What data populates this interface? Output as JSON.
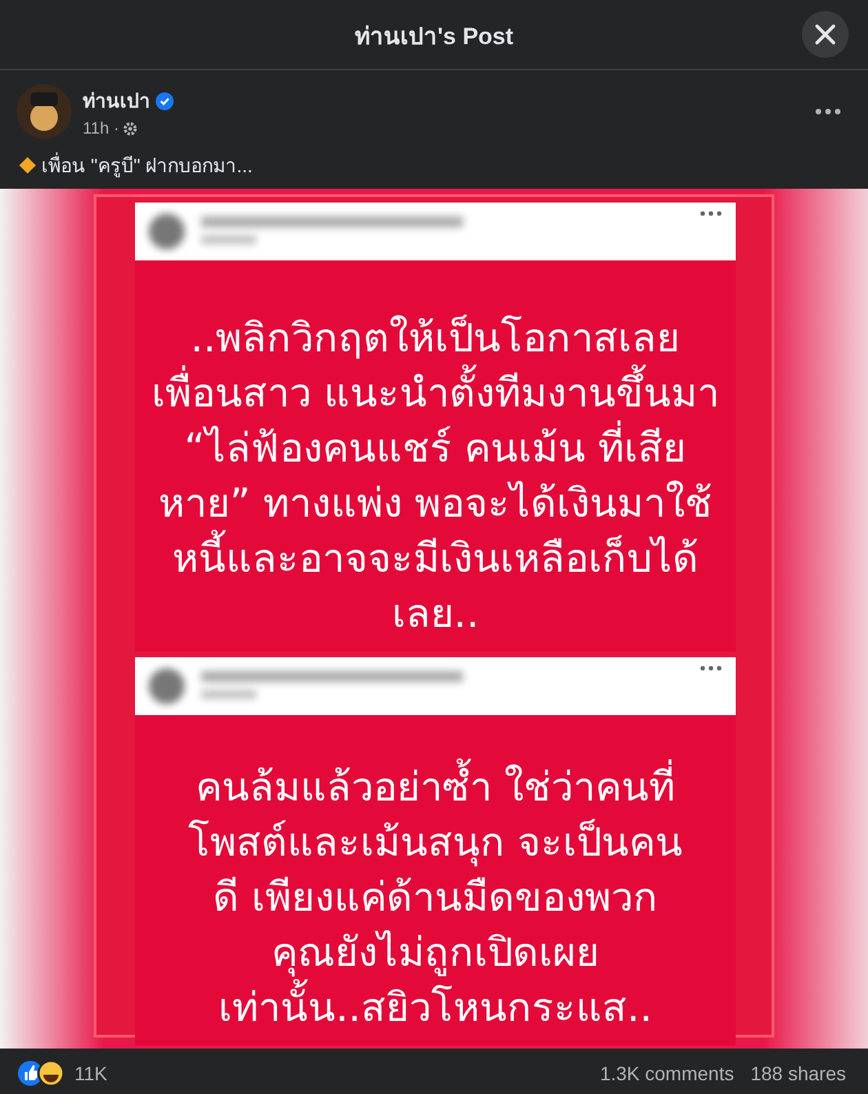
{
  "dialog": {
    "title": "ท่านเปา's Post"
  },
  "post": {
    "author": "ท่านเปา",
    "verified": true,
    "time": "11h ·",
    "text": "เพื่อน \"ครูบี\" ฝากบอกมา..."
  },
  "image": {
    "cards": [
      {
        "lines": [
          "..พลิกวิกฤตให้เป็นโอกาสเลย",
          "เพื่อนสาว แนะนำตั้งทีมงานขึ้นมา",
          "“ไล่ฟ้องคนแชร์ คนเม้น ที่เสีย",
          "หาย” ทางแพ่ง พอจะได้เงินมาใช้",
          "หนี้และอาจจะมีเงินเหลือเก็บได้",
          "เลย.."
        ]
      },
      {
        "lines": [
          "คนล้มแล้วอย่าซ้ำ ใช่ว่าคนที่",
          "โพสต์และเม้นสนุก จะเป็นคน",
          "ดี เพียงแค่ด้านมืดของพวก",
          "คุณยังไม่ถูกเปิดเผย",
          "เท่านั้น..สยิวโหนกระแส.."
        ]
      }
    ]
  },
  "footer": {
    "reactions": "11K",
    "comments": "1.3K comments",
    "shares": "188 shares"
  }
}
